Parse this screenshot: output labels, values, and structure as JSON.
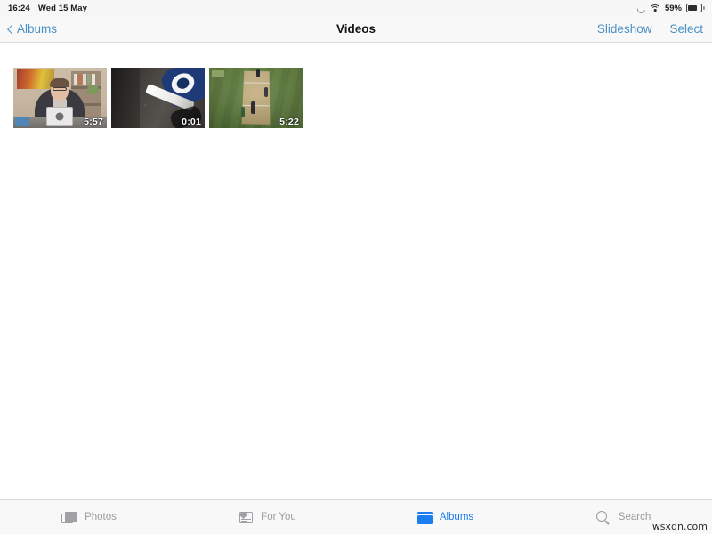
{
  "status_bar": {
    "time": "16:24",
    "date": "Wed 15 May",
    "battery_percent": "59%",
    "icons": [
      "rotation-lock-icon",
      "wifi-icon",
      "battery-icon"
    ]
  },
  "nav_bar": {
    "back_label": "Albums",
    "title": "Videos",
    "slideshow_label": "Slideshow",
    "select_label": "Select"
  },
  "grid": {
    "items": [
      {
        "duration": "5:57",
        "description": "person-at-desk-with-tablet"
      },
      {
        "duration": "0:01",
        "description": "asphalt-close-up"
      },
      {
        "duration": "5:22",
        "description": "cricket-pitch",
        "badge": "channel-logo"
      }
    ]
  },
  "tab_bar": {
    "tabs": [
      {
        "label": "Photos",
        "icon": "photos-icon",
        "active": false
      },
      {
        "label": "For You",
        "icon": "for-you-icon",
        "active": false
      },
      {
        "label": "Albums",
        "icon": "albums-icon",
        "active": true
      },
      {
        "label": "Search",
        "icon": "search-icon",
        "active": false
      }
    ],
    "active_color": "#1a7df0",
    "inactive_color": "#9a9a9f"
  },
  "watermark": "wsxdn.com"
}
